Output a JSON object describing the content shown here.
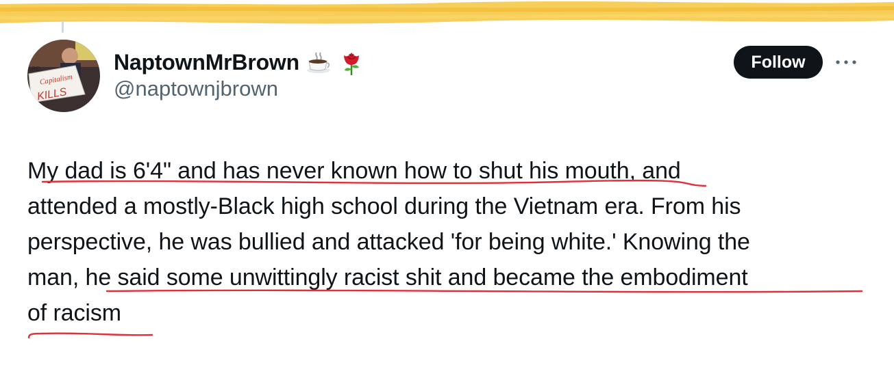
{
  "author": {
    "display_name": "NaptownMrBrown",
    "handle": "@naptownjbrown",
    "name_emojis": [
      "hot-beverage",
      "rose"
    ]
  },
  "actions": {
    "follow_label": "Follow",
    "more_icon": "more-horizontal-icon"
  },
  "tweet": {
    "lines": [
      "My dad is 6'4\" and has never known how to shut his mouth, and",
      "attended a mostly-Black high school during the Vietnam era. From his",
      "perspective, he was bullied and attacked 'for being white.' Knowing the",
      "man, he said some unwittingly racist shit and became the embodiment",
      "of racism"
    ]
  },
  "colors": {
    "highlight": "#f7c948",
    "underline_annotation": "#e0303a",
    "follow_bg": "#0f1419",
    "handle": "#536471"
  },
  "avatar": {
    "sign_text": "Capitalism KILLS"
  }
}
